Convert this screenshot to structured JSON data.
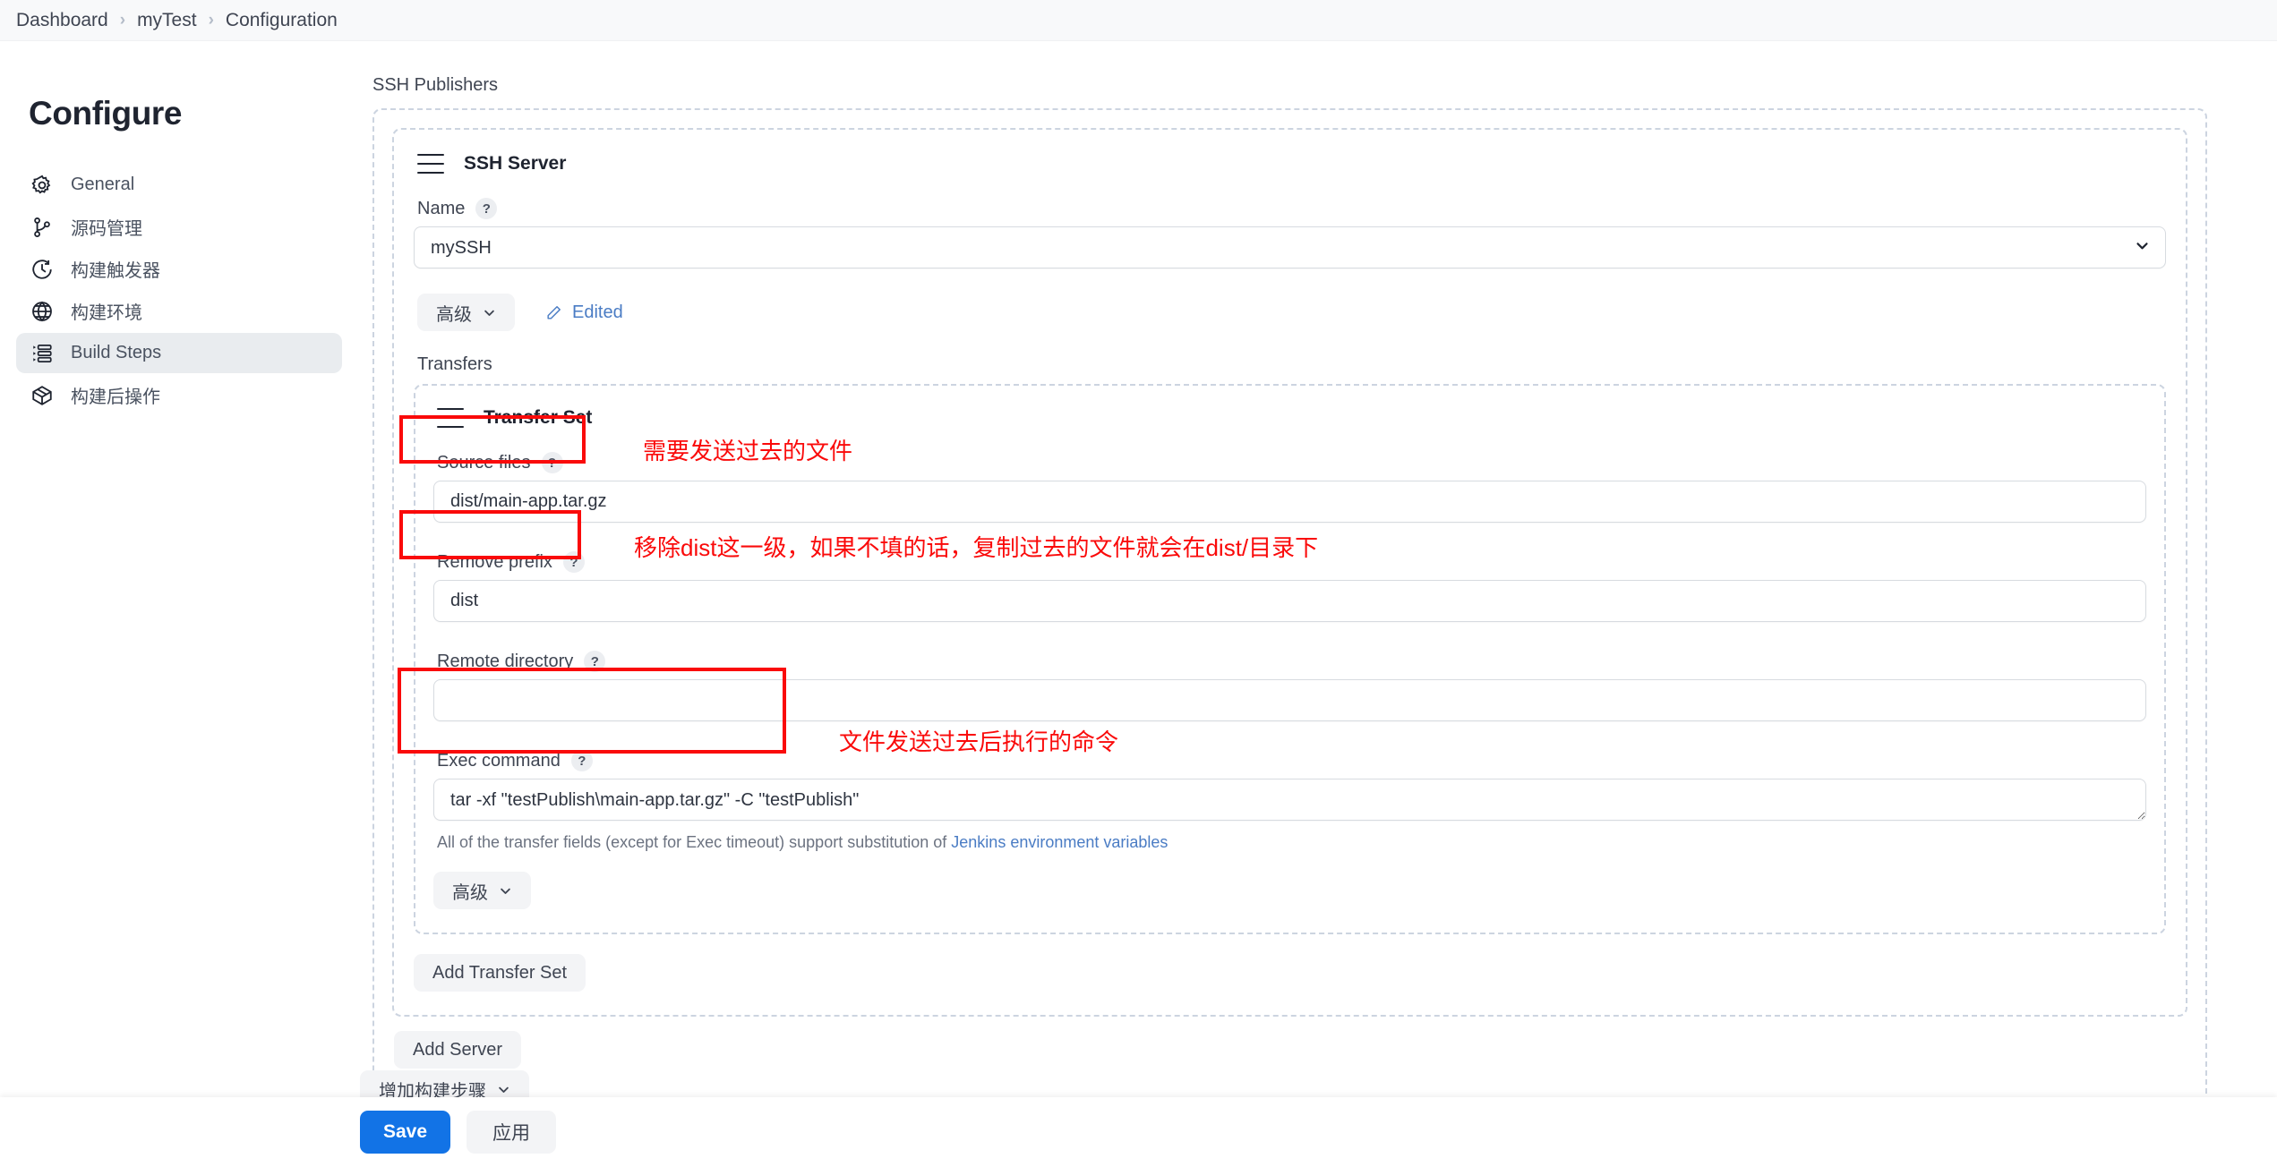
{
  "breadcrumb": {
    "items": [
      {
        "label": "Dashboard"
      },
      {
        "label": "myTest"
      },
      {
        "label": "Configuration"
      }
    ],
    "separator": "›"
  },
  "sidebar": {
    "title": "Configure",
    "items": [
      {
        "label": "General",
        "icon": "gear-icon",
        "active": false
      },
      {
        "label": "源码管理",
        "icon": "git-branch-icon",
        "active": false
      },
      {
        "label": "构建触发器",
        "icon": "clock-icon",
        "active": false
      },
      {
        "label": "构建环境",
        "icon": "globe-icon",
        "active": false
      },
      {
        "label": "Build Steps",
        "icon": "list-steps-icon",
        "active": true
      },
      {
        "label": "构建后操作",
        "icon": "package-icon",
        "active": false
      }
    ]
  },
  "main": {
    "ssh_publishers_label": "SSH Publishers",
    "ssh_server": {
      "panel_title": "SSH Server",
      "name_label": "Name",
      "help_glyph": "?",
      "name_value": "mySSH",
      "name_options": [
        "mySSH"
      ],
      "advanced_label": "高级",
      "edited_label": "Edited",
      "transfers_label": "Transfers"
    },
    "transfer_set": {
      "panel_title": "Transfer Set",
      "source_files_label": "Source files",
      "source_files_value": "dist/main-app.tar.gz",
      "remove_prefix_label": "Remove prefix",
      "remove_prefix_value": "dist",
      "remote_directory_label": "Remote directory",
      "remote_directory_value": "",
      "exec_command_label": "Exec command",
      "exec_command_value": "tar -xf \"testPublish\\main-app.tar.gz\" -C \"testPublish\"",
      "hint_prefix": "All of the transfer fields (except for Exec timeout) support substitution of ",
      "hint_link": "Jenkins environment variables",
      "advanced_label": "高级"
    },
    "add_transfer_set_label": "Add Transfer Set",
    "add_server_label": "Add Server",
    "server_advanced_label": "高级",
    "add_build_step_label": "增加构建步骤"
  },
  "annotations": {
    "color": "#fa0a0a",
    "notes": [
      {
        "text": "需要发送过去的文件"
      },
      {
        "text": "移除dist这一级，如果不填的话，复制过去的文件就会在dist/目录下"
      },
      {
        "text": "文件发送过去后执行的命令"
      }
    ]
  },
  "footer": {
    "save_label": "Save",
    "apply_label": "应用"
  }
}
